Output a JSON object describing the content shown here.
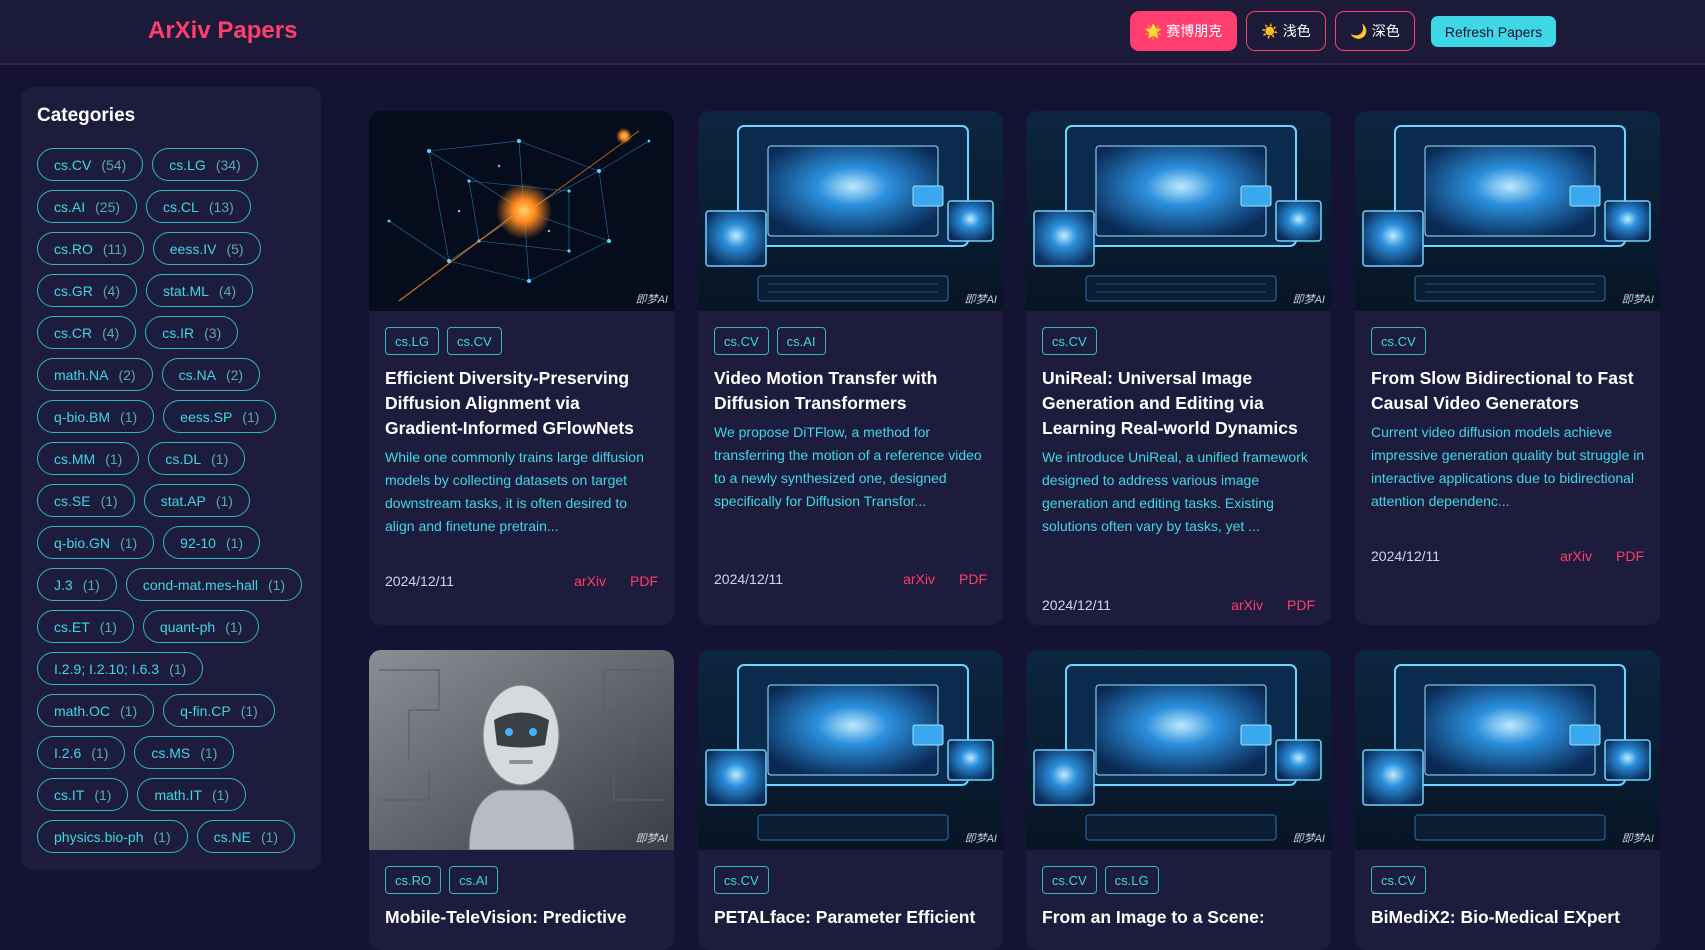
{
  "header": {
    "brand": "ArXiv Papers",
    "themes": [
      {
        "icon": "🌟",
        "label": "赛博朋克"
      },
      {
        "icon": "☀️",
        "label": "浅色"
      },
      {
        "icon": "🌙",
        "label": "深色"
      }
    ],
    "refresh_label": "Refresh Papers"
  },
  "sidebar": {
    "title": "Categories",
    "categories": [
      {
        "name": "cs.CV",
        "count": "(54)"
      },
      {
        "name": "cs.LG",
        "count": "(34)"
      },
      {
        "name": "cs.AI",
        "count": "(25)"
      },
      {
        "name": "cs.CL",
        "count": "(13)"
      },
      {
        "name": "cs.RO",
        "count": "(11)"
      },
      {
        "name": "eess.IV",
        "count": "(5)"
      },
      {
        "name": "cs.GR",
        "count": "(4)"
      },
      {
        "name": "stat.ML",
        "count": "(4)"
      },
      {
        "name": "cs.CR",
        "count": "(4)"
      },
      {
        "name": "cs.IR",
        "count": "(3)"
      },
      {
        "name": "math.NA",
        "count": "(2)"
      },
      {
        "name": "cs.NA",
        "count": "(2)"
      },
      {
        "name": "q-bio.BM",
        "count": "(1)"
      },
      {
        "name": "eess.SP",
        "count": "(1)"
      },
      {
        "name": "cs.MM",
        "count": "(1)"
      },
      {
        "name": "cs.DL",
        "count": "(1)"
      },
      {
        "name": "cs.SE",
        "count": "(1)"
      },
      {
        "name": "stat.AP",
        "count": "(1)"
      },
      {
        "name": "q-bio.GN",
        "count": "(1)"
      },
      {
        "name": "92-10",
        "count": "(1)"
      },
      {
        "name": "J.3",
        "count": "(1)"
      },
      {
        "name": "cond-mat.mes-hall",
        "count": "(1)"
      },
      {
        "name": "cs.ET",
        "count": "(1)"
      },
      {
        "name": "quant-ph",
        "count": "(1)"
      },
      {
        "name": "I.2.9; I.2.10; I.6.3",
        "count": "(1)"
      },
      {
        "name": "math.OC",
        "count": "(1)"
      },
      {
        "name": "q-fin.CP",
        "count": "(1)"
      },
      {
        "name": "I.2.6",
        "count": "(1)"
      },
      {
        "name": "cs.MS",
        "count": "(1)"
      },
      {
        "name": "cs.IT",
        "count": "(1)"
      },
      {
        "name": "math.IT",
        "count": "(1)"
      },
      {
        "name": "physics.bio-ph",
        "count": "(1)"
      },
      {
        "name": "cs.NE",
        "count": "(1)"
      }
    ]
  },
  "papers": [
    {
      "image": "neural-network-art",
      "watermark": "即梦AI",
      "tags": [
        "cs.LG",
        "cs.CV"
      ],
      "title": "Efficient Diversity-Preserving Diffusion Alignment via Gradient-Informed GFlowNets",
      "abstract": "While one commonly trains large diffusion models by collecting datasets on target downstream tasks, it is often desired to align and finetune pretrain...",
      "date": "2024/12/11",
      "arxiv_label": "arXiv",
      "pdf_label": "PDF"
    },
    {
      "image": "computer-screens-art",
      "watermark": "即梦AI",
      "tags": [
        "cs.CV",
        "cs.AI"
      ],
      "title": "Video Motion Transfer with Diffusion Transformers",
      "abstract": "We propose DiTFlow, a method for transferring the motion of a reference video to a newly synthesized one, designed specifically for Diffusion Transfor...",
      "date": "2024/12/11",
      "arxiv_label": "arXiv",
      "pdf_label": "PDF"
    },
    {
      "image": "computer-screens-art",
      "watermark": "即梦AI",
      "tags": [
        "cs.CV"
      ],
      "title": "UniReal: Universal Image Generation and Editing via Learning Real-world Dynamics",
      "abstract": "We introduce UniReal, a unified framework designed to address various image generation and editing tasks. Existing solutions often vary by tasks, yet ...",
      "date": "2024/12/11",
      "arxiv_label": "arXiv",
      "pdf_label": "PDF"
    },
    {
      "image": "computer-screens-art",
      "watermark": "即梦AI",
      "tags": [
        "cs.CV"
      ],
      "title": "From Slow Bidirectional to Fast Causal Video Generators",
      "abstract": "Current video diffusion models achieve impressive generation quality but struggle in interactive applications due to bidirectional attention dependenc...",
      "date": "2024/12/11",
      "arxiv_label": "arXiv",
      "pdf_label": "PDF"
    },
    {
      "image": "robot-art",
      "watermark": "即梦AI",
      "tags": [
        "cs.RO",
        "cs.AI"
      ],
      "title": "Mobile-TeleVision: Predictive"
    },
    {
      "image": "computer-screens-art",
      "watermark": "即梦AI",
      "tags": [
        "cs.CV"
      ],
      "title": "PETALface: Parameter Efficient"
    },
    {
      "image": "computer-screens-art",
      "watermark": "即梦AI",
      "tags": [
        "cs.CV",
        "cs.LG"
      ],
      "title": "From an Image to a Scene:"
    },
    {
      "image": "computer-screens-art",
      "watermark": "即梦AI",
      "tags": [
        "cs.CV"
      ],
      "title": "BiMediX2: Bio-Medical EXpert"
    }
  ]
}
